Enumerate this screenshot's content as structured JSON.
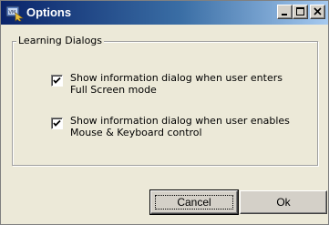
{
  "window": {
    "title": "Options",
    "icon": "vm-app-icon",
    "controls": [
      "minimize-icon",
      "maximize-icon",
      "close-icon"
    ]
  },
  "group": {
    "label": "Learning Dialogs",
    "options": [
      {
        "line1": "Show information dialog when user enters",
        "line2": "Full Screen mode",
        "checked": true
      },
      {
        "line1": "Show information dialog when user enables",
        "line2": "Mouse & Keyboard control",
        "checked": true
      }
    ]
  },
  "buttons": {
    "cancel": "Cancel",
    "ok": "Ok"
  },
  "colors": {
    "title_start": "#0a246a",
    "title_end": "#a6caf0",
    "face": "#d4d0c8"
  }
}
